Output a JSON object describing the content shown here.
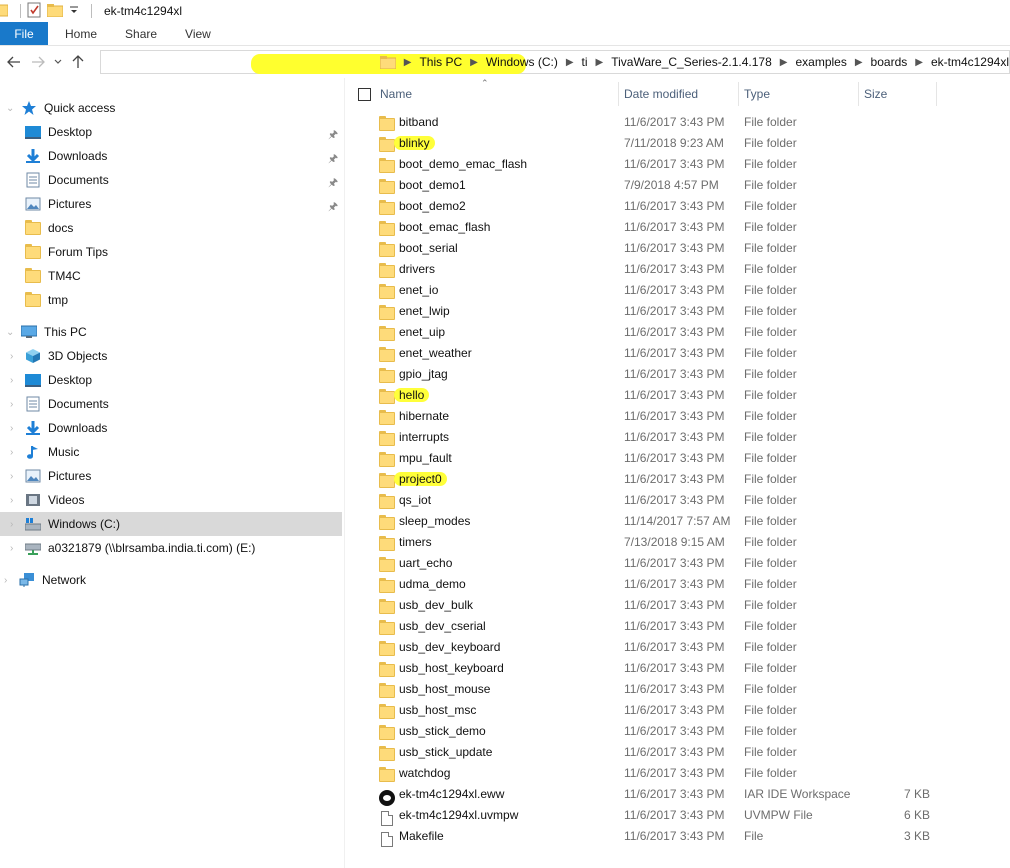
{
  "window": {
    "title": "ek-tm4c1294xl"
  },
  "ribbon": {
    "tabs": [
      "File",
      "Home",
      "Share",
      "View"
    ]
  },
  "address": {
    "crumbs": [
      "This PC",
      "Windows (C:)",
      "ti",
      "TivaWare_C_Series-2.1.4.178",
      "examples",
      "boards",
      "ek-tm4c1294xl"
    ]
  },
  "nav": {
    "quick_access": "Quick access",
    "qa_items": [
      "Desktop",
      "Downloads",
      "Documents",
      "Pictures",
      "docs",
      "Forum Tips",
      "TM4C",
      "tmp"
    ],
    "this_pc": "This PC",
    "pc_items": [
      "3D Objects",
      "Desktop",
      "Documents",
      "Downloads",
      "Music",
      "Pictures",
      "Videos",
      "Windows (C:)",
      "a0321879 (\\\\blrsamba.india.ti.com) (E:)"
    ],
    "network": "Network"
  },
  "columns": {
    "name": "Name",
    "date": "Date modified",
    "type": "Type",
    "size": "Size"
  },
  "files": [
    {
      "name": "bitband",
      "date": "11/6/2017 3:43 PM",
      "type": "File folder",
      "size": "",
      "icon": "folder-icon",
      "hl": false
    },
    {
      "name": "blinky",
      "date": "7/11/2018 9:23 AM",
      "type": "File folder",
      "size": "",
      "icon": "folder-icon",
      "hl": true
    },
    {
      "name": "boot_demo_emac_flash",
      "date": "11/6/2017 3:43 PM",
      "type": "File folder",
      "size": "",
      "icon": "folder-icon",
      "hl": false
    },
    {
      "name": "boot_demo1",
      "date": "7/9/2018 4:57 PM",
      "type": "File folder",
      "size": "",
      "icon": "folder-icon",
      "hl": false
    },
    {
      "name": "boot_demo2",
      "date": "11/6/2017 3:43 PM",
      "type": "File folder",
      "size": "",
      "icon": "folder-icon",
      "hl": false
    },
    {
      "name": "boot_emac_flash",
      "date": "11/6/2017 3:43 PM",
      "type": "File folder",
      "size": "",
      "icon": "folder-icon",
      "hl": false
    },
    {
      "name": "boot_serial",
      "date": "11/6/2017 3:43 PM",
      "type": "File folder",
      "size": "",
      "icon": "folder-icon",
      "hl": false
    },
    {
      "name": "drivers",
      "date": "11/6/2017 3:43 PM",
      "type": "File folder",
      "size": "",
      "icon": "folder-icon",
      "hl": false
    },
    {
      "name": "enet_io",
      "date": "11/6/2017 3:43 PM",
      "type": "File folder",
      "size": "",
      "icon": "folder-icon",
      "hl": false
    },
    {
      "name": "enet_lwip",
      "date": "11/6/2017 3:43 PM",
      "type": "File folder",
      "size": "",
      "icon": "folder-icon",
      "hl": false
    },
    {
      "name": "enet_uip",
      "date": "11/6/2017 3:43 PM",
      "type": "File folder",
      "size": "",
      "icon": "folder-icon",
      "hl": false
    },
    {
      "name": "enet_weather",
      "date": "11/6/2017 3:43 PM",
      "type": "File folder",
      "size": "",
      "icon": "folder-icon",
      "hl": false
    },
    {
      "name": "gpio_jtag",
      "date": "11/6/2017 3:43 PM",
      "type": "File folder",
      "size": "",
      "icon": "folder-icon",
      "hl": false
    },
    {
      "name": "hello",
      "date": "11/6/2017 3:43 PM",
      "type": "File folder",
      "size": "",
      "icon": "folder-icon",
      "hl": true
    },
    {
      "name": "hibernate",
      "date": "11/6/2017 3:43 PM",
      "type": "File folder",
      "size": "",
      "icon": "folder-icon",
      "hl": false
    },
    {
      "name": "interrupts",
      "date": "11/6/2017 3:43 PM",
      "type": "File folder",
      "size": "",
      "icon": "folder-icon",
      "hl": false
    },
    {
      "name": "mpu_fault",
      "date": "11/6/2017 3:43 PM",
      "type": "File folder",
      "size": "",
      "icon": "folder-icon",
      "hl": false
    },
    {
      "name": "project0",
      "date": "11/6/2017 3:43 PM",
      "type": "File folder",
      "size": "",
      "icon": "folder-icon",
      "hl": true
    },
    {
      "name": "qs_iot",
      "date": "11/6/2017 3:43 PM",
      "type": "File folder",
      "size": "",
      "icon": "folder-icon",
      "hl": false
    },
    {
      "name": "sleep_modes",
      "date": "11/14/2017 7:57 AM",
      "type": "File folder",
      "size": "",
      "icon": "folder-icon",
      "hl": false
    },
    {
      "name": "timers",
      "date": "7/13/2018 9:15 AM",
      "type": "File folder",
      "size": "",
      "icon": "folder-icon",
      "hl": false
    },
    {
      "name": "uart_echo",
      "date": "11/6/2017 3:43 PM",
      "type": "File folder",
      "size": "",
      "icon": "folder-icon",
      "hl": false
    },
    {
      "name": "udma_demo",
      "date": "11/6/2017 3:43 PM",
      "type": "File folder",
      "size": "",
      "icon": "folder-icon",
      "hl": false
    },
    {
      "name": "usb_dev_bulk",
      "date": "11/6/2017 3:43 PM",
      "type": "File folder",
      "size": "",
      "icon": "folder-icon",
      "hl": false
    },
    {
      "name": "usb_dev_cserial",
      "date": "11/6/2017 3:43 PM",
      "type": "File folder",
      "size": "",
      "icon": "folder-icon",
      "hl": false
    },
    {
      "name": "usb_dev_keyboard",
      "date": "11/6/2017 3:43 PM",
      "type": "File folder",
      "size": "",
      "icon": "folder-icon",
      "hl": false
    },
    {
      "name": "usb_host_keyboard",
      "date": "11/6/2017 3:43 PM",
      "type": "File folder",
      "size": "",
      "icon": "folder-icon",
      "hl": false
    },
    {
      "name": "usb_host_mouse",
      "date": "11/6/2017 3:43 PM",
      "type": "File folder",
      "size": "",
      "icon": "folder-icon",
      "hl": false
    },
    {
      "name": "usb_host_msc",
      "date": "11/6/2017 3:43 PM",
      "type": "File folder",
      "size": "",
      "icon": "folder-icon",
      "hl": false
    },
    {
      "name": "usb_stick_demo",
      "date": "11/6/2017 3:43 PM",
      "type": "File folder",
      "size": "",
      "icon": "folder-icon",
      "hl": false
    },
    {
      "name": "usb_stick_update",
      "date": "11/6/2017 3:43 PM",
      "type": "File folder",
      "size": "",
      "icon": "folder-icon",
      "hl": false
    },
    {
      "name": "watchdog",
      "date": "11/6/2017 3:43 PM",
      "type": "File folder",
      "size": "",
      "icon": "folder-icon",
      "hl": false
    },
    {
      "name": "ek-tm4c1294xl.eww",
      "date": "11/6/2017 3:43 PM",
      "type": "IAR IDE Workspace",
      "size": "7 KB",
      "icon": "iar-workspace-icon",
      "hl": false
    },
    {
      "name": "ek-tm4c1294xl.uvmpw",
      "date": "11/6/2017 3:43 PM",
      "type": "UVMPW File",
      "size": "6 KB",
      "icon": "document-icon",
      "hl": false
    },
    {
      "name": "Makefile",
      "date": "11/6/2017 3:43 PM",
      "type": "File",
      "size": "3 KB",
      "icon": "document-icon",
      "hl": false
    }
  ]
}
